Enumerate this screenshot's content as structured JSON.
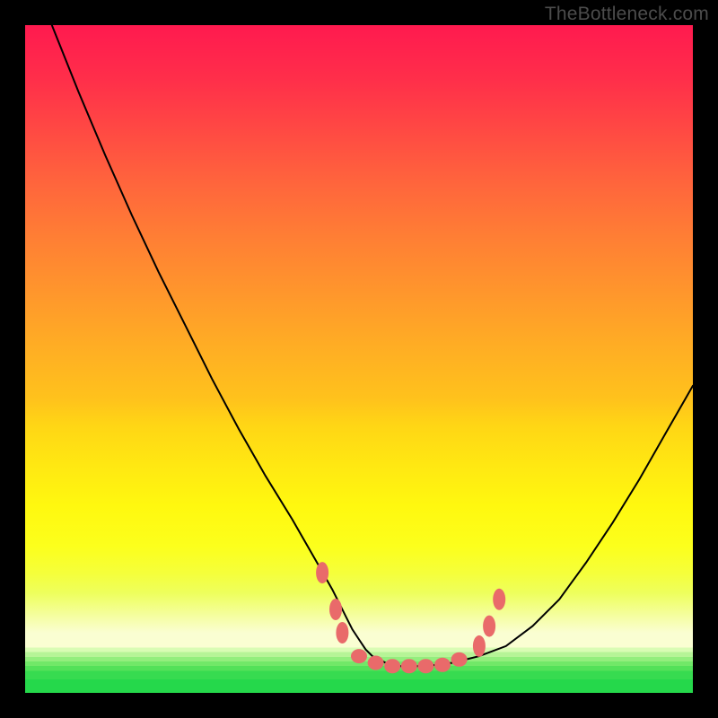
{
  "watermark": "TheBottleneck.com",
  "colors": {
    "frame_border": "#000000",
    "curve_stroke": "#000000",
    "marker_fill": "#e96a6a",
    "gradient_top": "#ff1a4f",
    "gradient_mid": "#fff80f",
    "gradient_bottom": "#25d84b"
  },
  "chart_data": {
    "type": "line",
    "title": "",
    "xlabel": "",
    "ylabel": "",
    "xlim": [
      0,
      100
    ],
    "ylim": [
      0,
      100
    ],
    "grid": false,
    "legend": false,
    "series": [
      {
        "name": "bottleneck-curve",
        "x": [
          4,
          8,
          12,
          16,
          20,
          24,
          28,
          32,
          36,
          40,
          42,
          44,
          46,
          47,
          48,
          49,
          50,
          51,
          52,
          53,
          54,
          56,
          58,
          60,
          64,
          68,
          72,
          76,
          80,
          84,
          88,
          92,
          96,
          100
        ],
        "y": [
          100,
          90,
          80.5,
          71.5,
          63,
          55,
          47,
          39.5,
          32.5,
          26,
          22.5,
          19,
          15.5,
          13.5,
          11.5,
          9.5,
          8,
          6.5,
          5.5,
          5,
          4.5,
          4,
          4,
          4,
          4.5,
          5.5,
          7,
          10,
          14,
          19.5,
          25.5,
          32,
          39,
          46
        ],
        "note": "y is the vertical gap from the bottom edge of the gradient square, 0–100 scale; curve descends steeply from top-left, flattens at the green bottom around x≈50–62, rises again less steeply to the right edge."
      }
    ],
    "markers": {
      "comment": "salmon pill-shaped markers clustered where the curve meets the green band near the bottom",
      "points": [
        {
          "x": 44.5,
          "y": 18,
          "shape": "oval-vert"
        },
        {
          "x": 46.5,
          "y": 12.5,
          "shape": "oval-vert"
        },
        {
          "x": 47.5,
          "y": 9,
          "shape": "oval-vert"
        },
        {
          "x": 50,
          "y": 5.5,
          "shape": "circle"
        },
        {
          "x": 52.5,
          "y": 4.5,
          "shape": "circle"
        },
        {
          "x": 55,
          "y": 4,
          "shape": "circle"
        },
        {
          "x": 57.5,
          "y": 4,
          "shape": "circle"
        },
        {
          "x": 60,
          "y": 4,
          "shape": "circle"
        },
        {
          "x": 62.5,
          "y": 4.2,
          "shape": "circle"
        },
        {
          "x": 65,
          "y": 5,
          "shape": "circle"
        },
        {
          "x": 68,
          "y": 7,
          "shape": "oval-vert"
        },
        {
          "x": 69.5,
          "y": 10,
          "shape": "oval-vert"
        },
        {
          "x": 71,
          "y": 14,
          "shape": "oval-vert"
        }
      ]
    }
  }
}
